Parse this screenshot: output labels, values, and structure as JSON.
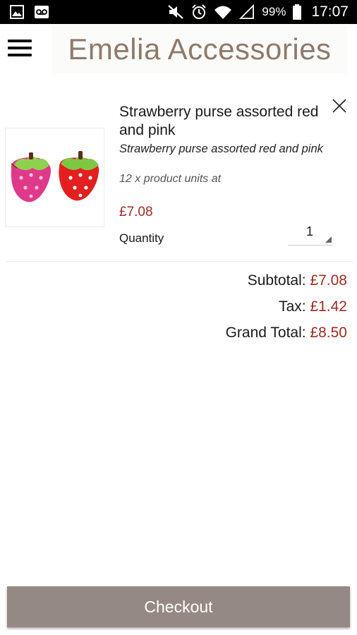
{
  "status_bar": {
    "battery_percent": "99%",
    "time": "17:07"
  },
  "header": {
    "logo_text": "Emelia Accessories"
  },
  "cart": {
    "item": {
      "title": "Strawberry purse assorted red and pink",
      "subtitle": "Strawberry purse assorted red and pink",
      "units_text": "12 x product units at",
      "price": "£7.08",
      "quantity_label": "Quantity",
      "quantity_value": "1"
    },
    "totals": {
      "subtotal_label": "Subtotal:",
      "subtotal_value": "£7.08",
      "tax_label": "Tax:",
      "tax_value": "£1.42",
      "grand_total_label": "Grand Total:",
      "grand_total_value": "£8.50"
    }
  },
  "checkout_label": "Checkout",
  "colors": {
    "price": "#9b2c23",
    "brand": "#8f7a6a",
    "checkout_button": "#958985"
  }
}
